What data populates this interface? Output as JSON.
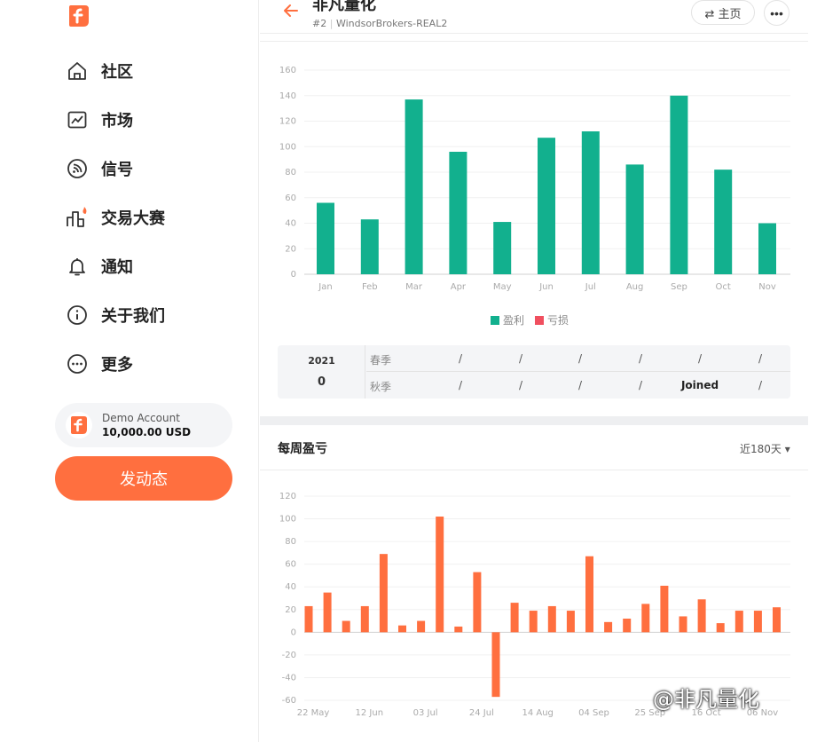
{
  "sidebar": {
    "items": [
      {
        "label": "社区",
        "icon": "home-icon"
      },
      {
        "label": "市场",
        "icon": "market-chart-icon"
      },
      {
        "label": "信号",
        "icon": "signal-icon"
      },
      {
        "label": "交易大赛",
        "icon": "contest-icon"
      },
      {
        "label": "通知",
        "icon": "bell-icon"
      },
      {
        "label": "关于我们",
        "icon": "info-icon"
      },
      {
        "label": "更多",
        "icon": "more-icon"
      }
    ],
    "account": {
      "type": "Demo Account",
      "balance": "10,000.00",
      "currency": "USD"
    },
    "post_button": "发动态"
  },
  "header": {
    "title": "非凡量化",
    "rank": "#2",
    "broker": "WindsorBrokers-REAL2",
    "home_label": "⇄ 主页",
    "more_label": "•••"
  },
  "legend": {
    "profit": "盈利",
    "loss": "亏损"
  },
  "colors": {
    "profit": "#12b08e",
    "loss": "#f04f5f",
    "accent": "#ff6f3f"
  },
  "season": {
    "year": "2021",
    "count": "0",
    "rows": [
      {
        "label": "春季",
        "cells": [
          "/",
          "/",
          "/",
          "/",
          "/",
          "/"
        ]
      },
      {
        "label": "秋季",
        "cells": [
          "/",
          "/",
          "/",
          "/",
          "Joined",
          "/"
        ]
      }
    ]
  },
  "weekly": {
    "title": "每周盈亏",
    "range": "近180天 ▾"
  },
  "watermark": "@非凡量化",
  "chart_data": [
    {
      "type": "bar",
      "categories": [
        "Jan",
        "Feb",
        "Mar",
        "Apr",
        "May",
        "Jun",
        "Jul",
        "Aug",
        "Sep",
        "Oct",
        "Nov"
      ],
      "series": [
        {
          "name": "盈利",
          "values": [
            56,
            43,
            137,
            96,
            41,
            107,
            112,
            86,
            140,
            82,
            40
          ]
        },
        {
          "name": "亏损",
          "values": [
            0,
            0,
            0,
            0,
            0,
            0,
            0,
            0,
            0,
            0,
            0
          ]
        }
      ],
      "yticks": [
        0,
        20,
        40,
        60,
        80,
        100,
        120,
        140,
        160
      ],
      "ylim": [
        0,
        160
      ],
      "grid": true,
      "legend": "bottom"
    },
    {
      "type": "bar",
      "title": "每周盈亏",
      "values": [
        23,
        35,
        10,
        23,
        69,
        6,
        10,
        102,
        5,
        53,
        -57,
        26,
        19,
        23,
        19,
        67,
        9,
        12,
        25,
        41,
        14,
        29,
        8,
        19,
        19,
        22
      ],
      "xtick_labels": [
        "22 May",
        "12 Jun",
        "03 Jul",
        "24 Jul",
        "14 Aug",
        "04 Sep",
        "25 Sep",
        "16 Oct",
        "06 Nov"
      ],
      "xtick_index": [
        0,
        3,
        6,
        9,
        12,
        15,
        18,
        21,
        24
      ],
      "yticks": [
        -60,
        -40,
        -20,
        0,
        20,
        40,
        60,
        80,
        100,
        120
      ],
      "ylim": [
        -60,
        120
      ],
      "grid": true
    }
  ]
}
